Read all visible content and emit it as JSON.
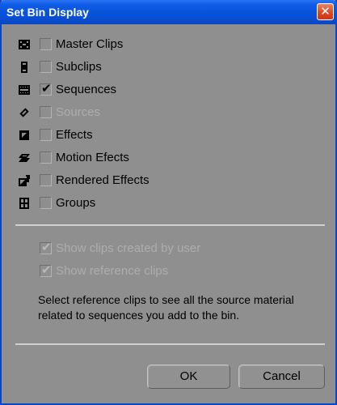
{
  "window": {
    "title": "Set Bin Display",
    "close_glyph": "✕"
  },
  "options": [
    {
      "label": "Master Clips",
      "checked": false,
      "disabled": false,
      "icon": "master-clip-icon"
    },
    {
      "label": "Subclips",
      "checked": false,
      "disabled": false,
      "icon": "subclip-icon"
    },
    {
      "label": "Sequences",
      "checked": true,
      "disabled": false,
      "icon": "sequence-icon"
    },
    {
      "label": "Sources",
      "checked": false,
      "disabled": true,
      "icon": "source-icon"
    },
    {
      "label": "Effects",
      "checked": false,
      "disabled": false,
      "icon": "effect-icon"
    },
    {
      "label": "Motion Efects",
      "checked": false,
      "disabled": false,
      "icon": "motion-effect-icon"
    },
    {
      "label": "Rendered Effects",
      "checked": false,
      "disabled": false,
      "icon": "rendered-effect-icon"
    },
    {
      "label": "Groups",
      "checked": false,
      "disabled": false,
      "icon": "group-icon"
    }
  ],
  "extra_options": [
    {
      "label": "Show clips created by user",
      "checked": true,
      "disabled": true
    },
    {
      "label": "Show reference clips",
      "checked": true,
      "disabled": true
    }
  ],
  "help_text": "Select reference clips to see all the source material related to sequences you add to the bin.",
  "buttons": {
    "ok": "OK",
    "cancel": "Cancel"
  },
  "colors": {
    "titlebar": "#0852db",
    "background": "#8f8f8f",
    "close": "#d8451f"
  }
}
